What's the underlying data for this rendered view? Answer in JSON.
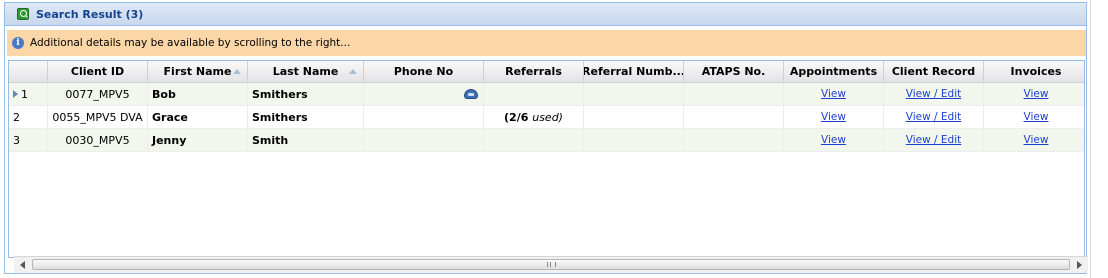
{
  "panel": {
    "title": "Search Result (3)",
    "icon": "search-result-icon"
  },
  "info": {
    "icon": "info-icon",
    "text": "Additional details may be available by scrolling to the right..."
  },
  "grid": {
    "columns": [
      {
        "key": "rownum",
        "label": ""
      },
      {
        "key": "client_id",
        "label": "Client ID"
      },
      {
        "key": "first_name",
        "label": "First Name",
        "sorted": "asc"
      },
      {
        "key": "last_name",
        "label": "Last Name",
        "sorted": "asc"
      },
      {
        "key": "phone",
        "label": "Phone No"
      },
      {
        "key": "referrals",
        "label": "Referrals"
      },
      {
        "key": "referral_number",
        "label": "Referral Numb..."
      },
      {
        "key": "ataps",
        "label": "ATAPS No."
      },
      {
        "key": "appointments",
        "label": "Appointments"
      },
      {
        "key": "client_record",
        "label": "Client Record"
      },
      {
        "key": "invoices",
        "label": "Invoices"
      }
    ],
    "rows": [
      {
        "rownum": "1",
        "client_id": "0077_MPV5",
        "first_name": "Bob",
        "last_name": "Smithers",
        "phone_icon": "phone-icon",
        "referrals_count": "",
        "referrals_note": "",
        "referral_number": "",
        "ataps": "",
        "appointments": "View",
        "client_record": "View / Edit",
        "invoices": "View",
        "selected": true
      },
      {
        "rownum": "2",
        "client_id": "0055_MPV5 DVA",
        "first_name": "Grace",
        "last_name": "Smithers",
        "phone_icon": "",
        "referrals_count": "(2/6",
        "referrals_note": "used)",
        "referral_number": "",
        "ataps": "",
        "appointments": "View",
        "client_record": "View / Edit",
        "invoices": "View",
        "selected": false
      },
      {
        "rownum": "3",
        "client_id": "0030_MPV5",
        "first_name": "Jenny",
        "last_name": "Smith",
        "phone_icon": "",
        "referrals_count": "",
        "referrals_note": "",
        "referral_number": "",
        "ataps": "",
        "appointments": "View",
        "client_record": "View / Edit",
        "invoices": "View",
        "selected": false
      }
    ]
  },
  "scrollbar": {
    "left_icon": "scroll-left-icon",
    "right_icon": "scroll-right-icon",
    "grip": "III"
  }
}
